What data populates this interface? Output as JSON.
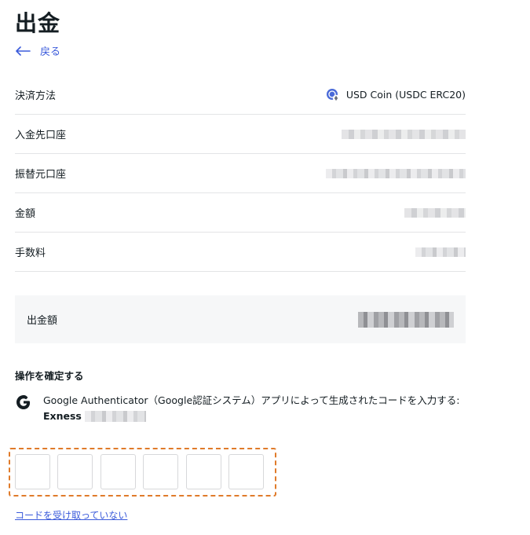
{
  "page": {
    "title": "出金",
    "back_label": "戻る"
  },
  "details": {
    "payment_method_label": "決済方法",
    "payment_method_value": "USD Coin (USDC ERC20)",
    "payment_method_icon": "usdc-coin-icon",
    "deposit_account_label": "入金先口座",
    "source_account_label": "振替元口座",
    "amount_label": "金額",
    "fee_label": "手数料"
  },
  "summary": {
    "withdrawal_amount_label": "出金額"
  },
  "confirm": {
    "title": "操作を確定する",
    "authenticator_text": "Google Authenticator（Google認証システム）アプリによって生成されたコードを入力する:",
    "account_name": "Exness",
    "otp_digits": [
      "",
      "",
      "",
      "",
      "",
      ""
    ],
    "resend_link": "コードを受け取っていない"
  },
  "colors": {
    "accent": "#3b5bdb",
    "highlight_border": "#e07b2a",
    "summary_bg": "#f6f7f8"
  }
}
